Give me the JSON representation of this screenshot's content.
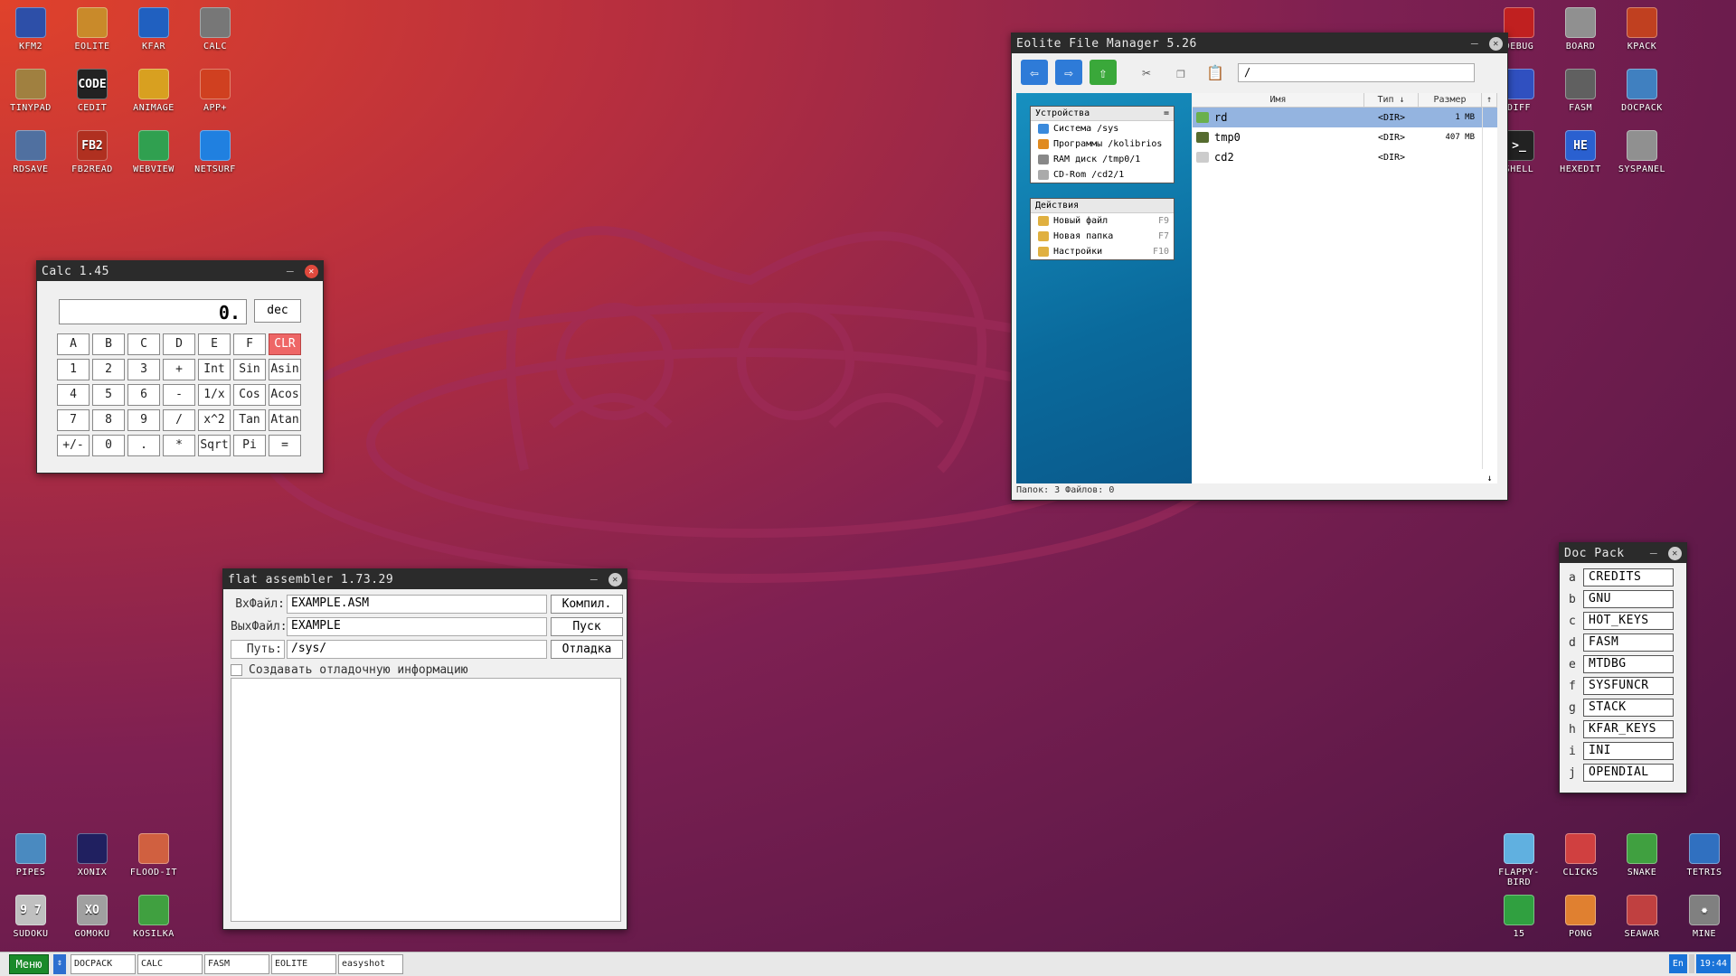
{
  "desktop_icons": [
    {
      "label": "KFM2",
      "icon": "floppy-icon",
      "color": "#2d4fa8"
    },
    {
      "label": "EOLITE",
      "icon": "folder-icon",
      "color": "#c98a2a"
    },
    {
      "label": "KFAR",
      "icon": "kfar-icon",
      "color": "#2060c0"
    },
    {
      "label": "CALC",
      "icon": "calculator-icon",
      "color": "#777777"
    },
    {
      "label": "TINYPAD",
      "icon": "notepad-icon",
      "color": "#a08040"
    },
    {
      "label": "CEDIT",
      "icon": "code-icon",
      "color": "#222222",
      "text": "CODE"
    },
    {
      "label": "ANIMAGE",
      "icon": "pencil-icon",
      "color": "#d8a020"
    },
    {
      "label": "APP+",
      "icon": "cube-icon",
      "color": "#d04020"
    },
    {
      "label": "RDSAVE",
      "icon": "disk-save-icon",
      "color": "#5070a0"
    },
    {
      "label": "FB2READ",
      "icon": "book-icon",
      "color": "#b03020",
      "text": "FB2"
    },
    {
      "label": "WEBVIEW",
      "icon": "web-icon",
      "color": "#30a050"
    },
    {
      "label": "NETSURF",
      "icon": "globe-icon",
      "color": "#2080e0"
    },
    {
      "label": "DEBUG",
      "icon": "bug-icon",
      "color": "#c02020"
    },
    {
      "label": "BOARD",
      "icon": "board-icon",
      "color": "#909090"
    },
    {
      "label": "KPACK",
      "icon": "hammer-icon",
      "color": "#c04020"
    },
    {
      "label": "DIFF",
      "icon": "diff-icon",
      "color": "#3050c0"
    },
    {
      "label": "FASM",
      "icon": "anvil-icon",
      "color": "#606060"
    },
    {
      "label": "DOCPACK",
      "icon": "docpack-icon",
      "color": "#4080c0"
    },
    {
      "label": "SHELL",
      "icon": "terminal-icon",
      "color": "#222222",
      "text": ">_"
    },
    {
      "label": "HEXEDIT",
      "icon": "hex-icon",
      "color": "#2a60d0",
      "text": "HE"
    },
    {
      "label": "SYSPANEL",
      "icon": "sliders-icon",
      "color": "#909090"
    },
    {
      "label": "PIPES",
      "icon": "pipes-icon",
      "color": "#4a8ac0"
    },
    {
      "label": "XONIX",
      "icon": "xonix-icon",
      "color": "#202060"
    },
    {
      "label": "FLOOD-IT",
      "icon": "flood-icon",
      "color": "#d06040"
    },
    {
      "label": "SUDOKU",
      "icon": "sudoku-icon",
      "color": "#c0c0c0",
      "text": "9 7"
    },
    {
      "label": "GOMOKU",
      "icon": "gomoku-icon",
      "color": "#a0a0a0",
      "text": "XO"
    },
    {
      "label": "KOSILKA",
      "icon": "mower-icon",
      "color": "#40a040"
    },
    {
      "label": "FLAPPY-BIRD",
      "icon": "bird-icon",
      "color": "#60b0e0"
    },
    {
      "label": "CLICKS",
      "icon": "clicks-icon",
      "color": "#d04040"
    },
    {
      "label": "SNAKE",
      "icon": "snake-icon",
      "color": "#40a040"
    },
    {
      "label": "TETRIS",
      "icon": "tetris-icon",
      "color": "#3070c0"
    },
    {
      "label": "15",
      "icon": "fifteen-icon",
      "color": "#30a040"
    },
    {
      "label": "PONG",
      "icon": "pong-icon",
      "color": "#e08030"
    },
    {
      "label": "SEAWAR",
      "icon": "ship-icon",
      "color": "#c04040"
    },
    {
      "label": "MINE",
      "icon": "mine-icon",
      "color": "#808080",
      "text": "✹"
    }
  ],
  "calc": {
    "title": "Calc 1.45",
    "display": "0.",
    "mode": "dec",
    "keys": [
      "A",
      "B",
      "C",
      "D",
      "E",
      "F",
      "CLR",
      "1",
      "2",
      "3",
      "+",
      "Int",
      "Sin",
      "Asin",
      "4",
      "5",
      "6",
      "-",
      "1/x",
      "Cos",
      "Acos",
      "7",
      "8",
      "9",
      "/",
      "x^2",
      "Tan",
      "Atan",
      "+/-",
      "0",
      ".",
      "*",
      "Sqrt",
      "Pi",
      "="
    ]
  },
  "fasm": {
    "title": "flat assembler 1.73.29",
    "in_label": "ВхФайл:",
    "in_value": "EXAMPLE.ASM",
    "compile": "Компил.",
    "out_label": "ВыхФайл:",
    "out_value": "EXAMPLE",
    "run": "Пуск",
    "path_label": "Путь:",
    "path_value": "/sys/",
    "debug": "Отладка",
    "debug_info": "Создавать отладочную информацию"
  },
  "eolite": {
    "title": "Eolite File Manager 5.26",
    "path": "/",
    "devices_title": "Устройства",
    "devices": [
      {
        "label": "Система /sys",
        "color": "#3a8adc"
      },
      {
        "label": "Программы /kolibrios",
        "color": "#e08a20"
      },
      {
        "label": "RAM диск /tmp0/1",
        "color": "#888888"
      },
      {
        "label": "CD-Rom /cd2/1",
        "color": "#aaaaaa"
      }
    ],
    "actions_title": "Действия",
    "actions": [
      {
        "label": "Новый файл",
        "key": "F9"
      },
      {
        "label": "Новая папка",
        "key": "F7"
      },
      {
        "label": "Настройки",
        "key": "F10"
      }
    ],
    "columns": {
      "name": "Имя",
      "type": "Тип ↓",
      "size": "Размер"
    },
    "files": [
      {
        "name": "rd",
        "type": "<DIR>",
        "size": "1 MB"
      },
      {
        "name": "tmp0",
        "type": "<DIR>",
        "size": "407 MB"
      },
      {
        "name": "cd2",
        "type": "<DIR>",
        "size": ""
      }
    ],
    "status": "Папок: 3  Файлов: 0"
  },
  "docpack": {
    "title": "Doc Pack",
    "items": [
      {
        "k": "a",
        "v": "CREDITS"
      },
      {
        "k": "b",
        "v": "GNU"
      },
      {
        "k": "c",
        "v": "HOT_KEYS"
      },
      {
        "k": "d",
        "v": "FASM"
      },
      {
        "k": "e",
        "v": "MTDBG"
      },
      {
        "k": "f",
        "v": "SYSFUNCR"
      },
      {
        "k": "g",
        "v": "STACK"
      },
      {
        "k": "h",
        "v": "KFAR_KEYS"
      },
      {
        "k": "i",
        "v": "INI"
      },
      {
        "k": "j",
        "v": "OPENDIAL"
      }
    ]
  },
  "taskbar": {
    "menu": "Меню",
    "tasks": [
      "DOCPACK",
      "CALC",
      "FASM",
      "EOLITE",
      "easyshot"
    ],
    "lang": "En",
    "time": "19:44"
  }
}
